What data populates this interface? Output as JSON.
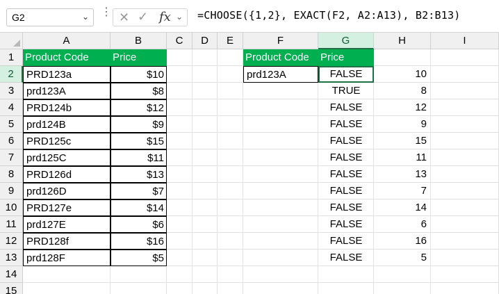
{
  "name_box": {
    "value": "G2"
  },
  "formula_bar": {
    "formula": "=CHOOSE({1,2}, EXACT(F2, A2:A13), B2:B13)",
    "fx_label": "fx"
  },
  "icons": {
    "cancel": "✕",
    "enter": "✓",
    "chevron": "⌄",
    "more": "⋮"
  },
  "columns": [
    "A",
    "B",
    "C",
    "D",
    "E",
    "F",
    "G",
    "H",
    "I"
  ],
  "rows": [
    "1",
    "2",
    "3",
    "4",
    "5",
    "6",
    "7",
    "8",
    "9",
    "10",
    "11",
    "12",
    "13",
    "14",
    "15"
  ],
  "colors": {
    "header_green": "#00b050",
    "selection_green": "#1e7145"
  },
  "table1": {
    "headers": [
      "Product Code",
      "Price"
    ],
    "rows": [
      [
        "PRD123a",
        "$10"
      ],
      [
        "prd123A",
        "$8"
      ],
      [
        "PRD124b",
        "$12"
      ],
      [
        "prd124B",
        "$9"
      ],
      [
        "PRD125c",
        "$15"
      ],
      [
        "prd125C",
        "$11"
      ],
      [
        "PRD126d",
        "$13"
      ],
      [
        "prd126D",
        "$7"
      ],
      [
        "PRD127e",
        "$14"
      ],
      [
        "prd127E",
        "$6"
      ],
      [
        "PRD128f",
        "$16"
      ],
      [
        "prd128F",
        "$5"
      ]
    ]
  },
  "lookup": {
    "headers": [
      "Product Code",
      "Price"
    ],
    "input": "prd123A"
  },
  "result": {
    "exact": [
      "FALSE",
      "TRUE",
      "FALSE",
      "FALSE",
      "FALSE",
      "FALSE",
      "FALSE",
      "FALSE",
      "FALSE",
      "FALSE",
      "FALSE",
      "FALSE"
    ],
    "price": [
      "10",
      "8",
      "12",
      "9",
      "15",
      "11",
      "13",
      "7",
      "14",
      "6",
      "16",
      "5"
    ]
  }
}
